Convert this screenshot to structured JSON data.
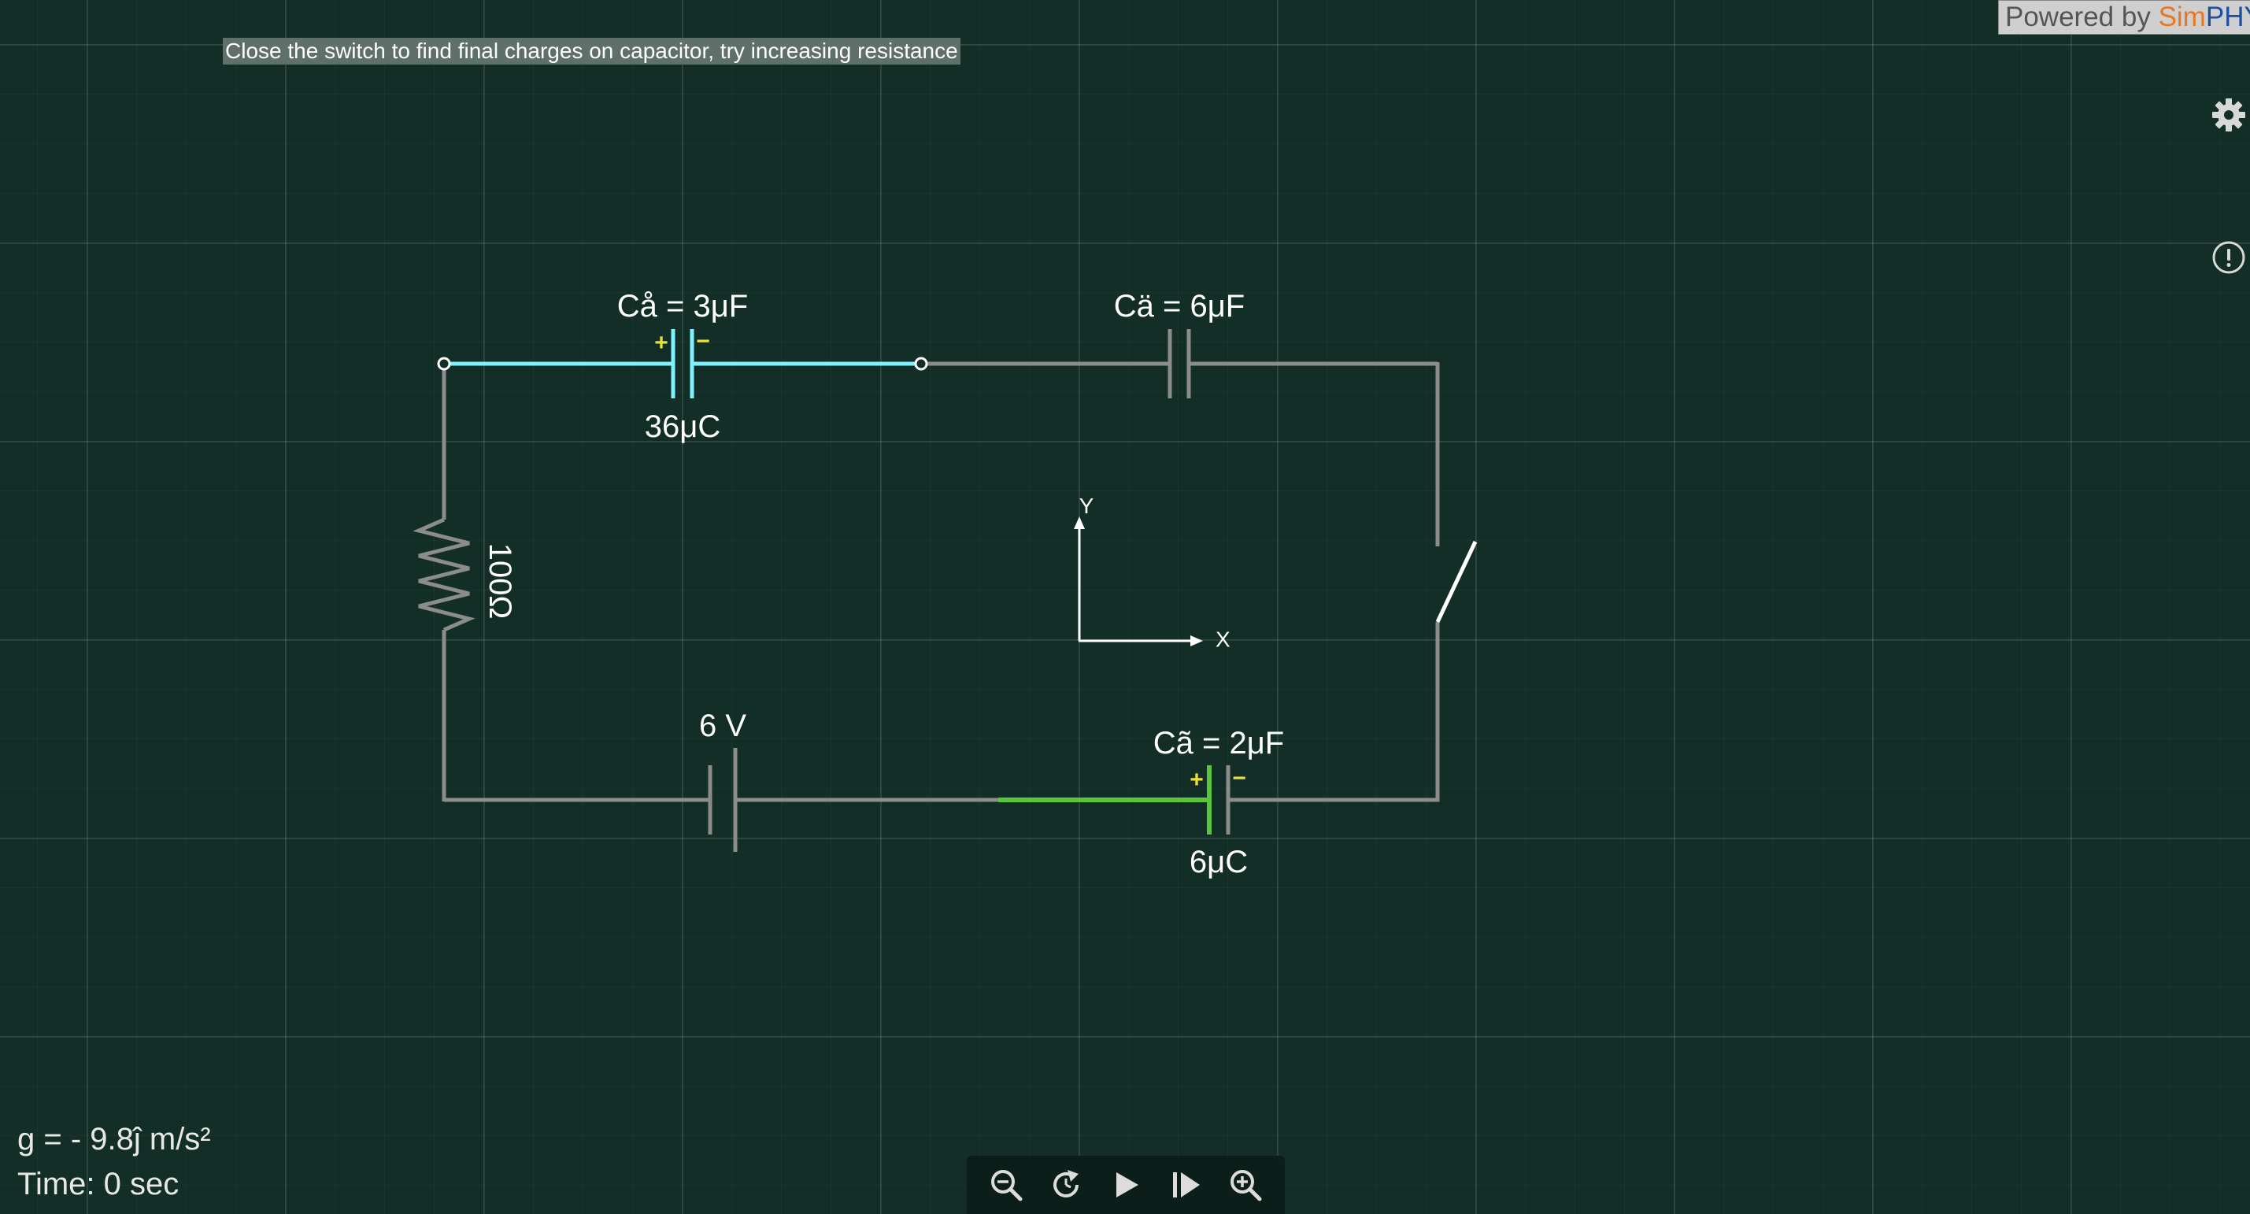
{
  "instruction": "Close the switch to find final charges on capacitor, try increasing resistance",
  "branding": {
    "prefix": "Powered by ",
    "sim": "Sim",
    "phy": "PHY"
  },
  "colors": {
    "background": "#132e26",
    "wire": "#8c8c8c",
    "highlight_cyan": "#7ff2ff",
    "highlight_green": "#5cc43d",
    "polarity": "#e6e03a"
  },
  "icons": {
    "settings": "gear-icon",
    "info": "info-icon"
  },
  "circuit": {
    "capacitor_1": {
      "label": "Cå = 3μF",
      "charge": "36μC",
      "plus": "+",
      "minus": "−"
    },
    "capacitor_2": {
      "label": "Cä = 6μF"
    },
    "capacitor_3": {
      "label": "Cã = 2μF",
      "charge": "6μC",
      "plus": "+",
      "minus": "−"
    },
    "resistor": {
      "label": "100Ω"
    },
    "battery": {
      "label": "6 V"
    },
    "switch": {
      "state": "open"
    },
    "axes": {
      "x": "X",
      "y": "Y"
    }
  },
  "status": {
    "gravity": "g = - 9.8ĵ m/s²",
    "time": "Time: 0 sec"
  },
  "toolbar": [
    "zoom-out",
    "reset",
    "play",
    "step",
    "zoom-in"
  ]
}
